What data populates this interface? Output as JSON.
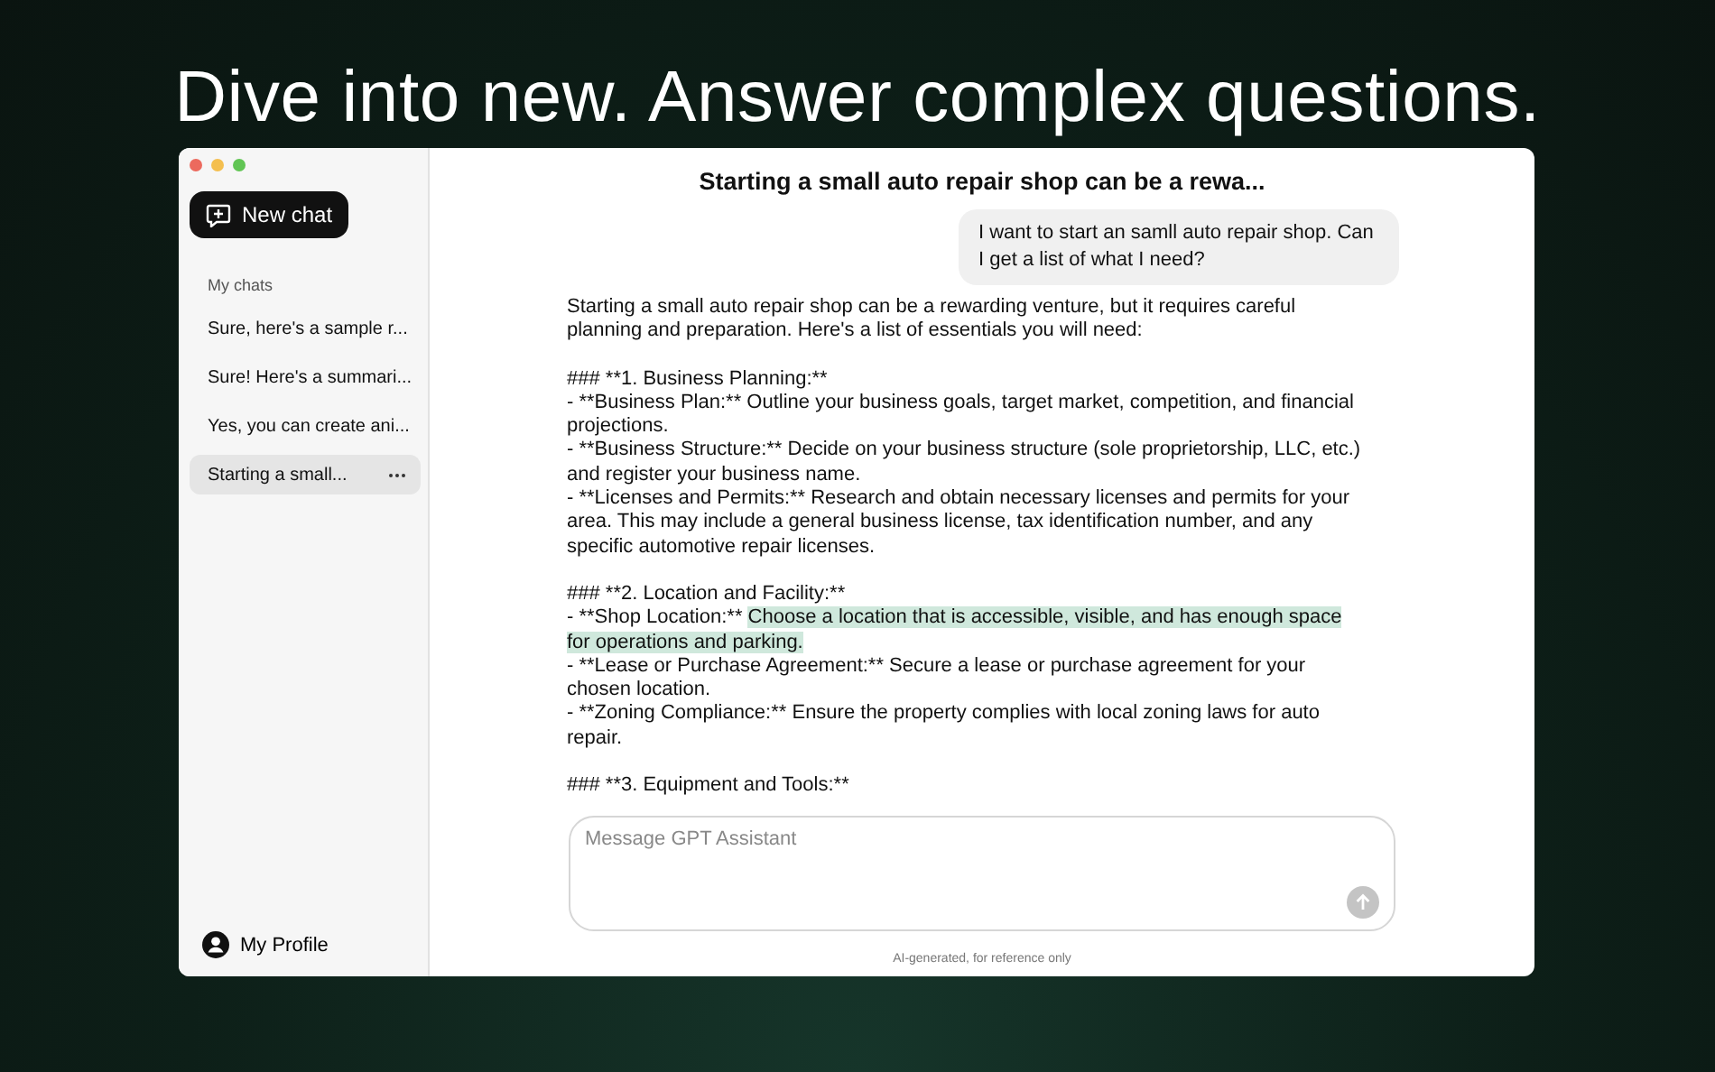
{
  "headline": "Dive into new. Answer complex questions.",
  "sidebar": {
    "new_chat": "New chat",
    "section": "My chats",
    "chats": [
      {
        "title": "Sure, here's a sample r...",
        "selected": false
      },
      {
        "title": "Sure! Here's a summari...",
        "selected": false
      },
      {
        "title": "Yes, you can create ani...",
        "selected": false
      },
      {
        "title": "Starting a small...",
        "selected": true
      }
    ],
    "profile": "My Profile"
  },
  "chat": {
    "title": "Starting a small auto repair shop can be a rewa...",
    "user_message": "I want to start an samll auto repair shop. Can I get a list of what I need?",
    "response": [
      {
        "items": [
          {
            "segments": [
              {
                "text": "Starting a small auto repair shop can be a rewarding venture, but it requires careful planning and preparation. Here's a list of essentials you will need:",
                "highlighted": false
              }
            ]
          }
        ]
      },
      {
        "items": [
          {
            "segments": [
              {
                "text": "### **1. Business Planning:**",
                "highlighted": false
              }
            ]
          },
          {
            "segments": [
              {
                "text": "- **Business Plan:** Outline your business goals, target market, competition, and financial projections.",
                "highlighted": false
              }
            ]
          },
          {
            "segments": [
              {
                "text": "- **Business Structure:** Decide on your business structure (sole proprietorship, LLC, etc.) and register your business name.",
                "highlighted": false
              }
            ]
          },
          {
            "segments": [
              {
                "text": "- **Licenses and Permits:** Research and obtain necessary licenses and permits for your area. This may include a general business license, tax identification number, and any specific automotive repair licenses.",
                "highlighted": false
              }
            ]
          }
        ]
      },
      {
        "items": [
          {
            "segments": [
              {
                "text": "### **2. Location and Facility:**",
                "highlighted": false
              }
            ]
          },
          {
            "segments": [
              {
                "text": "- **Shop Location:** ",
                "highlighted": false
              },
              {
                "text": "Choose a location that is accessible, visible, and has enough space for operations and parking.",
                "highlighted": true
              }
            ]
          },
          {
            "segments": [
              {
                "text": "- **Lease or Purchase Agreement:** Secure a lease or purchase agreement for your chosen location.",
                "highlighted": false
              }
            ]
          },
          {
            "segments": [
              {
                "text": "- **Zoning Compliance:** Ensure the property complies with local zoning laws for auto repair.",
                "highlighted": false
              }
            ]
          }
        ]
      },
      {
        "items": [
          {
            "segments": [
              {
                "text": "### **3. Equipment and Tools:**",
                "highlighted": false
              }
            ]
          }
        ]
      }
    ],
    "input": {
      "placeholder": "Message GPT Assistant"
    },
    "disclaimer": "AI-generated, for reference only"
  }
}
